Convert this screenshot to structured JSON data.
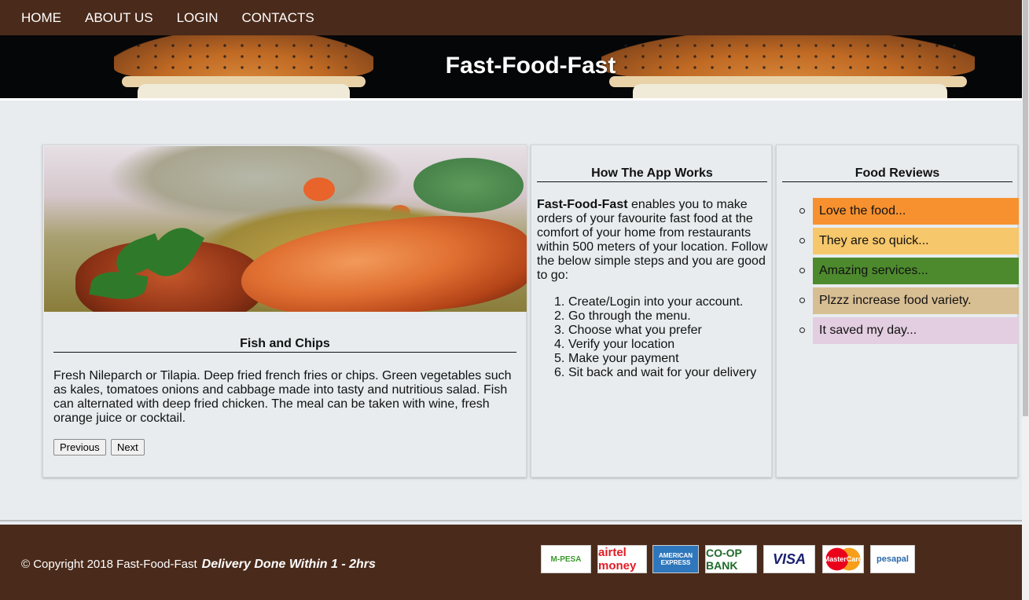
{
  "nav": {
    "items": [
      "HOME",
      "ABOUT US",
      "LOGIN",
      "CONTACTS"
    ]
  },
  "hero": {
    "title": "Fast-Food-Fast"
  },
  "food_card": {
    "title": "Fish and Chips",
    "description": "Fresh Nileparch or Tilapia. Deep fried french fries or chips. Green vegetables such as kales, tomatoes onions and cabbage made into tasty and nutritious salad. Fish can alternated with deep fried chicken. The meal can be taken with wine, fresh orange juice or cocktail.",
    "prev_label": "Previous",
    "next_label": "Next"
  },
  "how_card": {
    "title": "How The App Works",
    "brand": "Fast-Food-Fast",
    "intro": " enables you to make orders of your favourite fast food at the comfort of your home from restaurants within 500 meters of your location. Follow the below simple steps and you are good to go:",
    "steps": [
      "Create/Login into your account.",
      "Go through the menu.",
      "Choose what you prefer",
      "Verify your location",
      "Make your payment",
      "Sit back and wait for your delivery"
    ]
  },
  "reviews_card": {
    "title": "Food Reviews",
    "items": [
      {
        "text": "Love the food...",
        "color": "#f7912f"
      },
      {
        "text": "They are so quick...",
        "color": "#f6c76b"
      },
      {
        "text": "Amazing services...",
        "color": "#4d8a2d"
      },
      {
        "text": "Plzzz increase food variety.",
        "color": "#d8be93"
      },
      {
        "text": "It saved my day...",
        "color": "#e3cde0"
      }
    ]
  },
  "footer": {
    "copyright": "© Copyright 2018 Fast-Food-Fast",
    "delivery": "Delivery Done Within 1 - 2hrs",
    "payments": [
      "M-PESA",
      "airtel money",
      "AMERICAN EXPRESS",
      "CO-OP BANK",
      "VISA",
      "MasterCard",
      "pesapal"
    ]
  },
  "colors": {
    "brand_brown": "#4a2a1a",
    "page_bg": "#e8ecef"
  }
}
